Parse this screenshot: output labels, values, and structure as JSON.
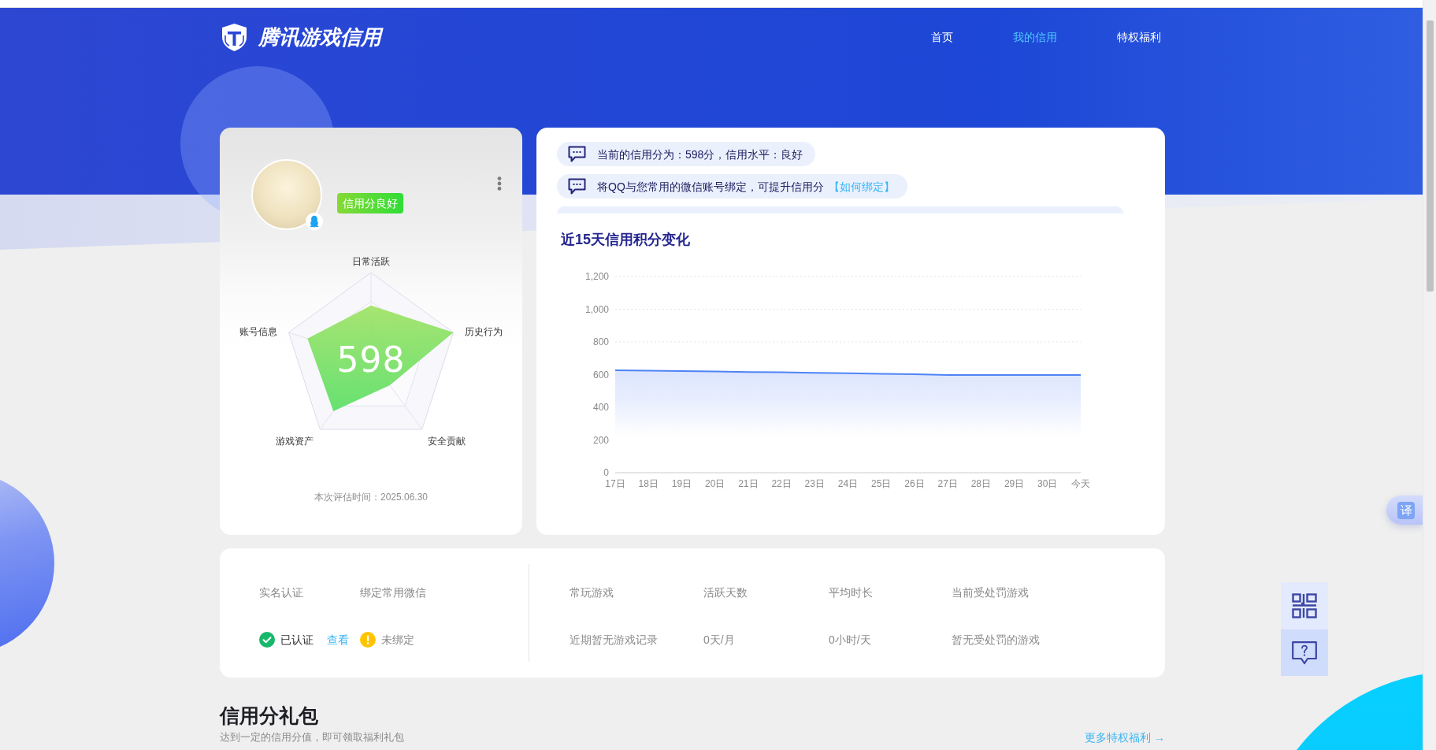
{
  "header": {
    "logo_text": "腾讯游戏信用",
    "nav": [
      {
        "label": "首页",
        "selected": false
      },
      {
        "label": "我的信用",
        "selected": true
      },
      {
        "label": "特权福利",
        "selected": false
      }
    ]
  },
  "profile": {
    "badge": "信用分良好",
    "score": "598",
    "radar_axes": [
      "日常活跃",
      "历史行为",
      "安全贡献",
      "游戏资产",
      "账号信息"
    ],
    "evaluation_time": "本次评估时间：2025.06.30"
  },
  "notices": {
    "items": [
      {
        "text": "当前的信用分为：598分，信用水平：良好"
      },
      {
        "text": "将QQ与您常用的微信账号绑定，可提升信用分",
        "link": "【如何绑定】"
      }
    ],
    "more_below": true
  },
  "score_chart": {
    "title": "近15天信用积分变化",
    "chart_data": {
      "type": "area",
      "categories": [
        "17日",
        "18日",
        "19日",
        "20日",
        "21日",
        "22日",
        "23日",
        "24日",
        "25日",
        "26日",
        "27日",
        "28日",
        "29日",
        "30日",
        "今天"
      ],
      "values": [
        626,
        624,
        621,
        619,
        616,
        614,
        611,
        608,
        605,
        602,
        598,
        598,
        598,
        598,
        598
      ],
      "ylim": [
        0,
        1200
      ],
      "yticks": [
        0,
        200,
        400,
        600,
        800,
        {
          "value": 1000,
          "label": "1,000"
        },
        {
          "value": 1200,
          "label": "1,200"
        }
      ]
    }
  },
  "account_status": [
    {
      "label": "实名认证",
      "kind": "verified",
      "status": "已认证",
      "link": "查看"
    },
    {
      "label": "绑定常用微信",
      "kind": "unbound",
      "status": "未绑定"
    }
  ],
  "game_stats": [
    {
      "label": "常玩游戏",
      "value": "近期暂无游戏记录"
    },
    {
      "label": "活跃天数",
      "value": "0天/月"
    },
    {
      "label": "平均时长",
      "value": "0小时/天"
    },
    {
      "label": "当前受处罚游戏",
      "value": "暂无受处罚的游戏"
    }
  ],
  "gift_section": {
    "title": "信用分礼包",
    "subtitle": "达到一定的信用分值，即可领取福利礼包",
    "more_link": "更多特权福利 →"
  },
  "side_tools": {
    "translate_label": "译"
  }
}
